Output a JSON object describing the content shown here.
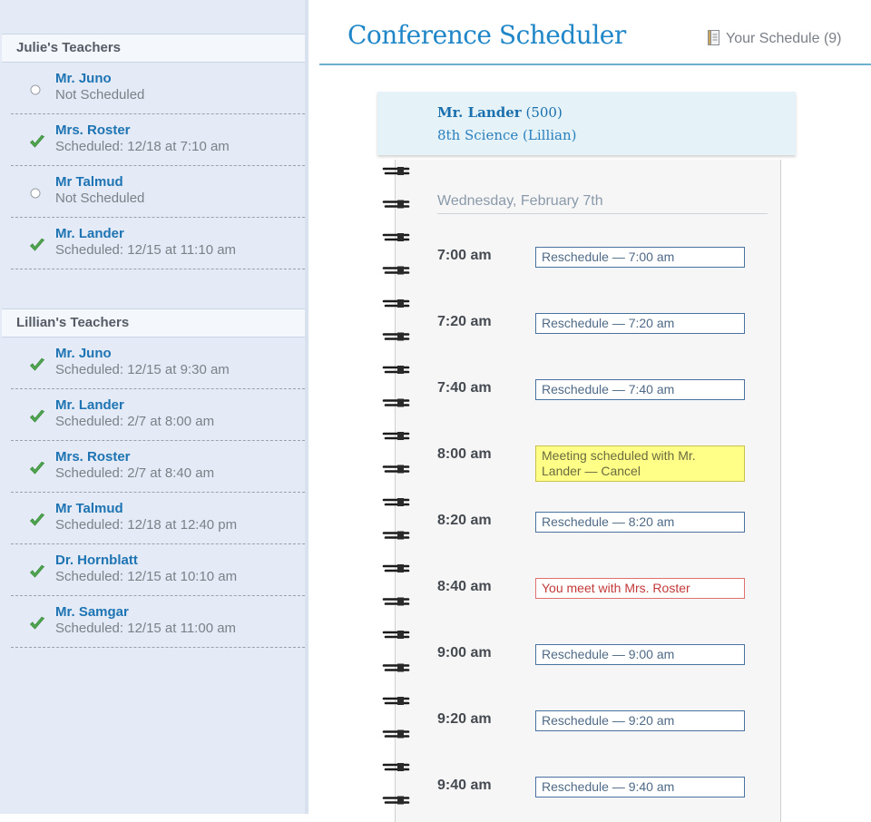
{
  "app": {
    "title": "Conference Scheduler",
    "schedule_link": "Your Schedule (9)",
    "accent": "#1f86c8"
  },
  "sidebar": {
    "groups": [
      {
        "header": "Julie's Teachers",
        "teachers": [
          {
            "name": "Mr. Juno",
            "status": "Not Scheduled",
            "state": "unscheduled"
          },
          {
            "name": "Mrs. Roster",
            "status": "Scheduled: 12/18 at 7:10 am",
            "state": "scheduled"
          },
          {
            "name": "Mr Talmud",
            "status": "Not Scheduled",
            "state": "unscheduled"
          },
          {
            "name": "Mr. Lander",
            "status": "Scheduled: 12/15 at 11:10 am",
            "state": "scheduled"
          }
        ]
      },
      {
        "header": "Lillian's Teachers",
        "teachers": [
          {
            "name": "Mr. Juno",
            "status": "Scheduled: 12/15 at 9:30 am",
            "state": "scheduled"
          },
          {
            "name": "Mr. Lander",
            "status": "Scheduled: 2/7 at 8:00 am",
            "state": "scheduled"
          },
          {
            "name": "Mrs. Roster",
            "status": "Scheduled: 2/7 at 8:40 am",
            "state": "scheduled"
          },
          {
            "name": "Mr Talmud",
            "status": "Scheduled: 12/18 at 12:40 pm",
            "state": "scheduled"
          },
          {
            "name": "Dr. Hornblatt",
            "status": "Scheduled: 12/15 at 10:10 am",
            "state": "scheduled"
          },
          {
            "name": "Mr. Samgar",
            "status": "Scheduled: 12/15 at 11:00 am",
            "state": "scheduled"
          }
        ]
      }
    ]
  },
  "teacher_card": {
    "name": "Mr. Lander",
    "room": "(500)",
    "course": "8th Science (Lillian)"
  },
  "schedule": {
    "day": "Wednesday, February 7th",
    "slots": [
      {
        "time": "7:00 am",
        "action": "Reschedule — 7:00 am",
        "kind": "reschedule"
      },
      {
        "time": "7:20 am",
        "action": "Reschedule — 7:20 am",
        "kind": "reschedule"
      },
      {
        "time": "7:40 am",
        "action": "Reschedule — 7:40 am",
        "kind": "reschedule"
      },
      {
        "time": "8:00 am",
        "action": "Meeting scheduled with Mr. Lander — Cancel",
        "kind": "meeting"
      },
      {
        "time": "8:20 am",
        "action": "Reschedule — 8:20 am",
        "kind": "reschedule"
      },
      {
        "time": "8:40 am",
        "action": "You meet with Mrs. Roster",
        "kind": "conflict"
      },
      {
        "time": "9:00 am",
        "action": "Reschedule — 9:00 am",
        "kind": "reschedule"
      },
      {
        "time": "9:20 am",
        "action": "Reschedule — 9:20 am",
        "kind": "reschedule"
      },
      {
        "time": "9:40 am",
        "action": "Reschedule — 9:40 am",
        "kind": "reschedule"
      }
    ]
  }
}
